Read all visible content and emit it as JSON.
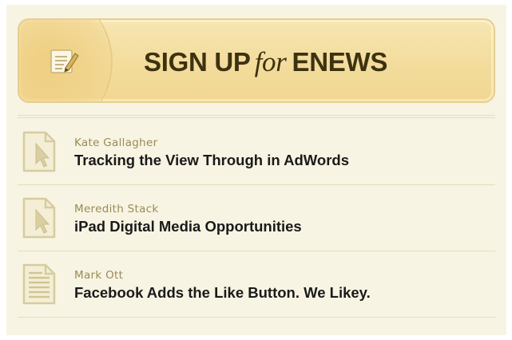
{
  "signup": {
    "prefix": "SIGN UP",
    "connector": "for",
    "suffix": "ENEWS"
  },
  "articles": [
    {
      "author": "Kate Gallagher",
      "title": "Tracking the View Through in AdWords",
      "icon": "cursor-document-icon"
    },
    {
      "author": "Meredith Stack",
      "title": "iPad Digital Media Opportunities",
      "icon": "cursor-document-icon"
    },
    {
      "author": "Mark Ott",
      "title": "Facebook Adds the Like Button. We Likey.",
      "icon": "text-document-icon"
    }
  ],
  "colors": {
    "panel_bg": "#f8f4e3",
    "button_gold": "#f3dc9c",
    "author_text": "#9a8a55",
    "title_text": "#1a1a1a"
  }
}
